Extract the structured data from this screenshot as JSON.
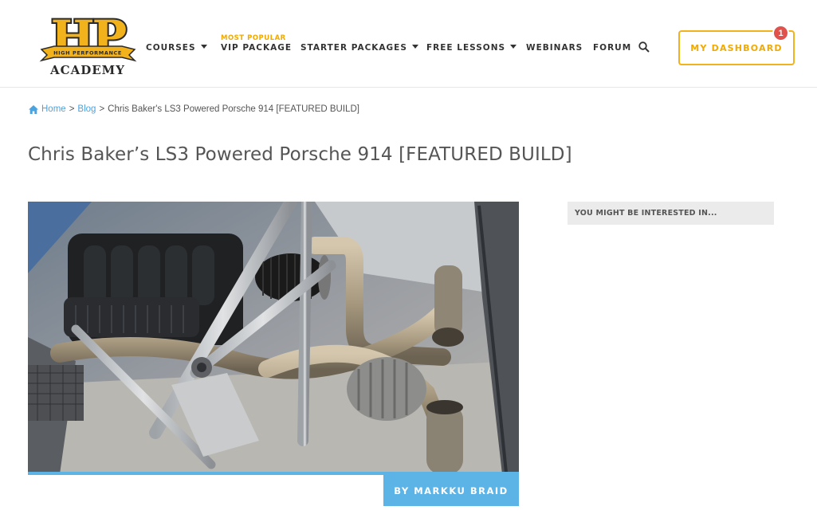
{
  "header": {
    "logo": {
      "letters": "HP",
      "ribbon_text": "HIGH PERFORMANCE",
      "sub_text": "ACADEMY"
    },
    "nav": [
      {
        "label": "COURSES",
        "has_dropdown": true
      },
      {
        "label": "VIP PACKAGE",
        "tag": "MOST POPULAR",
        "has_dropdown": false
      },
      {
        "label": "STARTER PACKAGES",
        "has_dropdown": true
      },
      {
        "label": "FREE LESSONS",
        "has_dropdown": true
      },
      {
        "label": "WEBINARS",
        "has_dropdown": false
      },
      {
        "label": "FORUM",
        "has_dropdown": false
      }
    ],
    "search_icon": "search-icon",
    "dashboard_button": {
      "label": "MY DASHBOARD",
      "notification_count": "1"
    }
  },
  "breadcrumb": {
    "home_icon": "home-icon",
    "items": [
      "Home",
      "Blog"
    ],
    "separator": ">",
    "current": "Chris Baker's LS3 Powered Porsche 914 [FEATURED BUILD]"
  },
  "article": {
    "title": "Chris Baker’s LS3 Powered Porsche 914 [FEATURED BUILD]",
    "author_tag": "BY MARKKU BRAID"
  },
  "sidebar": {
    "heading": "YOU MIGHT BE INTERESTED IN..."
  },
  "colors": {
    "accent": "#f2b21c",
    "link": "#4aa3df",
    "author_bg": "#5bb3e6",
    "badge": "#e2524c"
  }
}
